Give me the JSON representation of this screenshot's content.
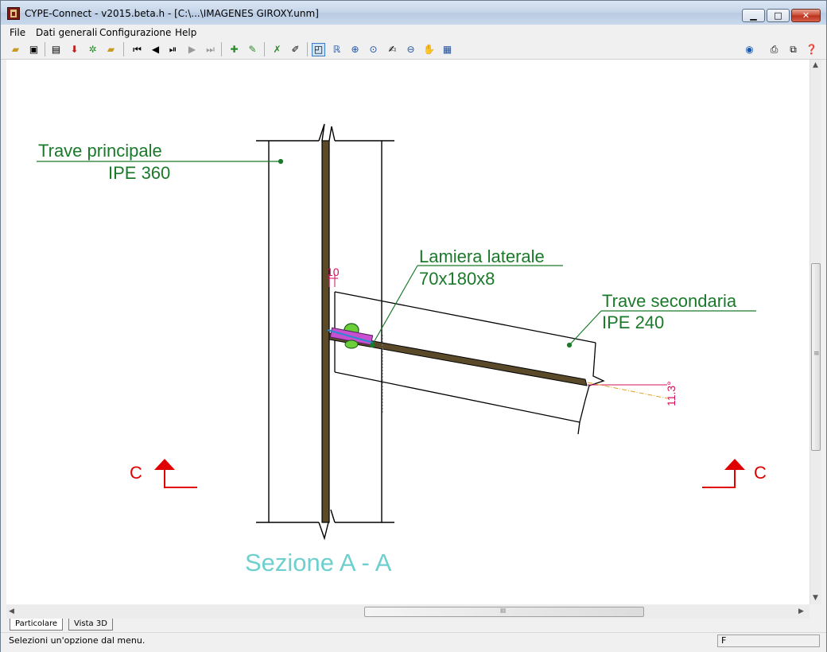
{
  "window": {
    "title": "CYPE-Connect - v2015.beta.h - [C:\\...\\IMAGENES GIROXY.unm]",
    "controls": {
      "minimize": "▁",
      "maximize": "□",
      "close": "✕"
    }
  },
  "menu": [
    {
      "label": "File",
      "hotkey": "F"
    },
    {
      "label": "Dati generali",
      "hotkey": "D"
    },
    {
      "label": "Configurazione",
      "hotkey": "C"
    },
    {
      "label": "Help",
      "hotkey": "H"
    }
  ],
  "toolbar": {
    "icons": [
      "open-icon",
      "save-icon",
      "general-data-icon",
      "import-icon",
      "connections-icon",
      "folder-icon",
      "first-icon",
      "previous-icon",
      "next-connection-icon",
      "next-icon",
      "last-icon",
      "add-beam-icon",
      "edit-beam-icon",
      "delete-check-icon",
      "check-icon",
      "zoom-window-icon",
      "redraw-icon",
      "zoom-all-icon",
      "zoom-in-icon",
      "measure-icon",
      "zoom-out-icon",
      "pan-icon",
      "views-icon",
      "web-icon",
      "print-icon",
      "export-icon",
      "help-icon"
    ]
  },
  "drawing": {
    "main_beam_label": "Trave principale",
    "main_beam_profile": "IPE 360",
    "plate_label": "Lamiera laterale",
    "plate_size": "70x180x8",
    "secondary_beam_label": "Trave secondaria",
    "secondary_beam_profile": "IPE 240",
    "gap_dim": "10",
    "angle_dim": "11.3°",
    "section_left": "C",
    "section_right": "C",
    "section_title": "Sezione A - A",
    "colors": {
      "label": "#1a7a2a",
      "dim": "#d0105a",
      "section_mark": "#e00000",
      "title": "#6fcfcf",
      "beam_web": "#5a4a2a"
    }
  },
  "tabs": [
    {
      "label": "Particolare",
      "active": true
    },
    {
      "label": "Vista 3D",
      "active": false
    }
  ],
  "status": {
    "message": "Selezioni un'opzione dal menu.",
    "field": "F"
  },
  "scrollbars": {
    "h_grip": "III",
    "v_grip": "≡"
  }
}
